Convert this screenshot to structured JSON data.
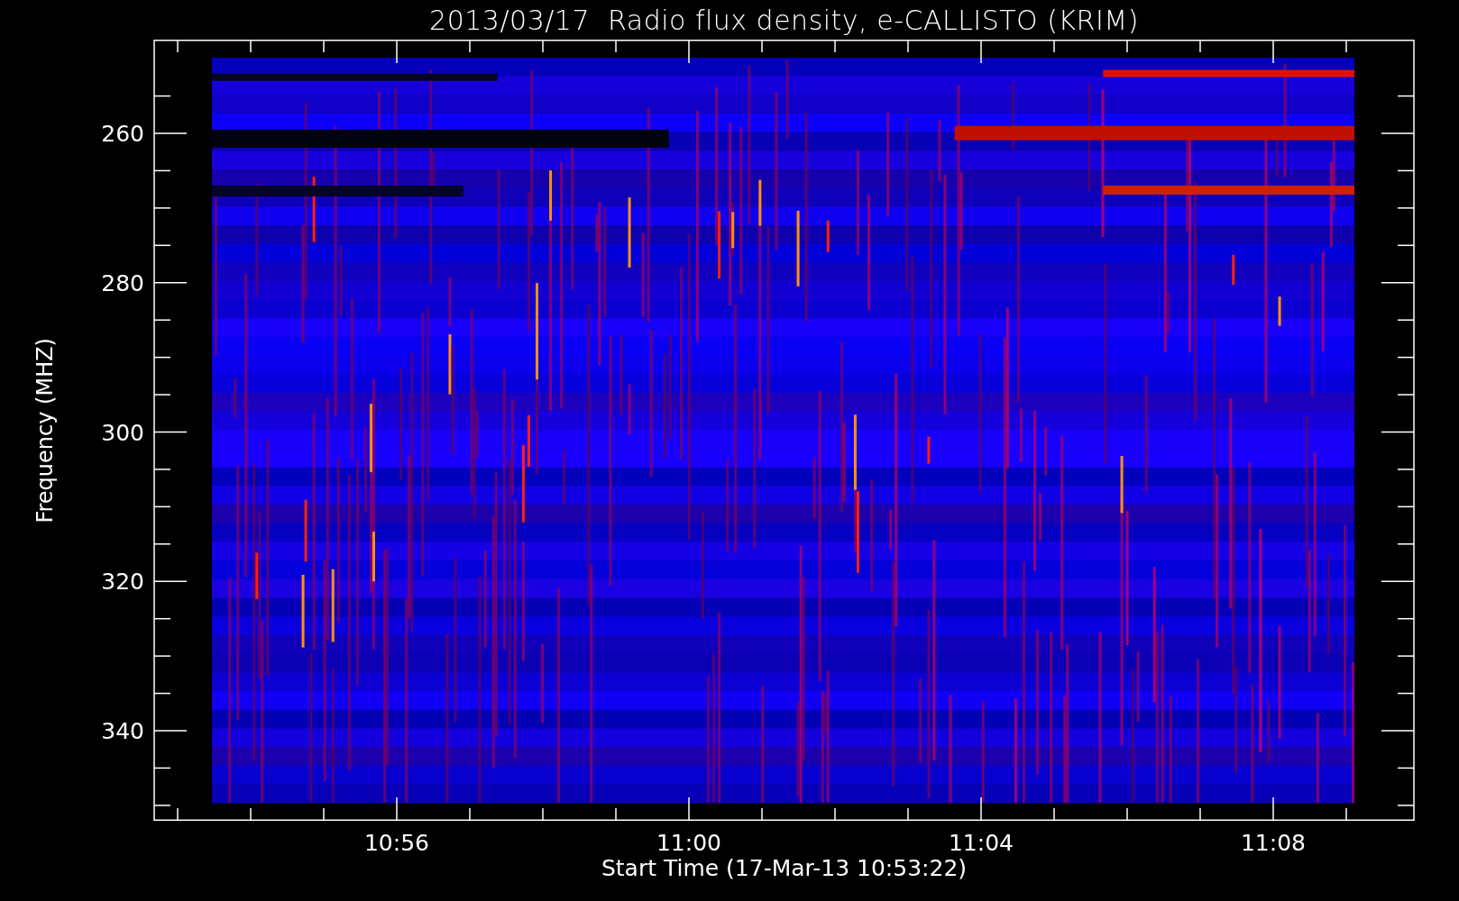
{
  "title": "2013/03/17  Radio flux density, e-CALLISTO (KRIM)",
  "y_axis": {
    "label": "Frequency (MHZ)",
    "ticks": [
      "260",
      "280",
      "300",
      "320",
      "340"
    ]
  },
  "x_axis": {
    "label": "Start Time (17-Mar-13 10:53:22)",
    "ticks": [
      "10:56",
      "11:00",
      "11:04",
      "11:08"
    ]
  }
}
